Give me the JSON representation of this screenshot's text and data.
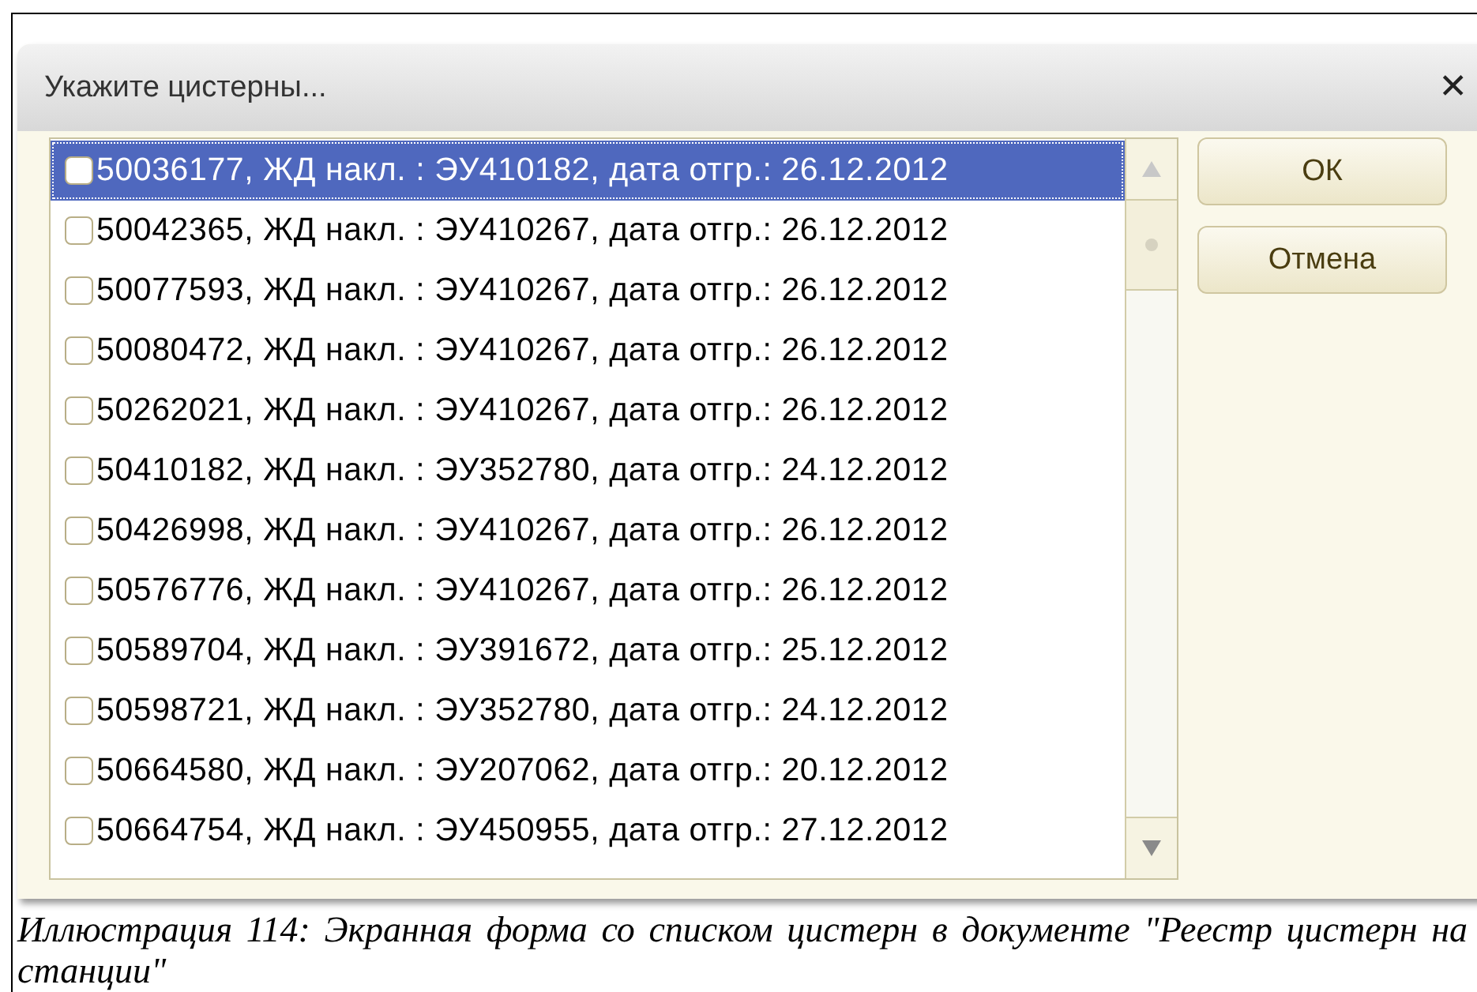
{
  "dialog": {
    "title": "Укажите цистерны...",
    "close": "✕",
    "items": [
      {
        "text": "50036177, ЖД накл. : ЭУ410182, дата отгр.: 26.12.2012",
        "checked": false,
        "selected": true
      },
      {
        "text": "50042365, ЖД накл. : ЭУ410267, дата отгр.: 26.12.2012",
        "checked": false,
        "selected": false
      },
      {
        "text": "50077593, ЖД накл. : ЭУ410267, дата отгр.: 26.12.2012",
        "checked": false,
        "selected": false
      },
      {
        "text": "50080472, ЖД накл. : ЭУ410267, дата отгр.: 26.12.2012",
        "checked": false,
        "selected": false
      },
      {
        "text": "50262021, ЖД накл. : ЭУ410267, дата отгр.: 26.12.2012",
        "checked": false,
        "selected": false
      },
      {
        "text": "50410182, ЖД накл. : ЭУ352780, дата отгр.: 24.12.2012",
        "checked": false,
        "selected": false
      },
      {
        "text": "50426998, ЖД накл. : ЭУ410267, дата отгр.: 26.12.2012",
        "checked": false,
        "selected": false
      },
      {
        "text": "50576776, ЖД накл. : ЭУ410267, дата отгр.: 26.12.2012",
        "checked": false,
        "selected": false
      },
      {
        "text": "50589704, ЖД накл. : ЭУ391672, дата отгр.: 25.12.2012",
        "checked": false,
        "selected": false
      },
      {
        "text": "50598721, ЖД накл. : ЭУ352780, дата отгр.: 24.12.2012",
        "checked": false,
        "selected": false
      },
      {
        "text": "50664580, ЖД накл. : ЭУ207062, дата отгр.: 20.12.2012",
        "checked": false,
        "selected": false
      },
      {
        "text": "50664754, ЖД накл. : ЭУ450955, дата отгр.: 27.12.2012",
        "checked": false,
        "selected": false
      }
    ],
    "buttons": [
      "ОК",
      "Отмена"
    ]
  },
  "caption": "Иллюстрация 114: Экранная форма со списком цистерн в документе \"Реестр цистерн на станции\""
}
